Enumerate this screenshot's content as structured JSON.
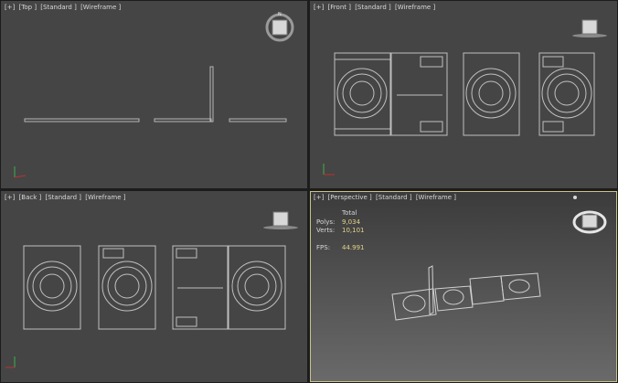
{
  "viewports": {
    "top": {
      "menu": "[+]",
      "view": "[Top ]",
      "shading": "[Standard ]",
      "mode": "[Wireframe ]"
    },
    "front": {
      "menu": "[+]",
      "view": "[Front ]",
      "shading": "[Standard ]",
      "mode": "[Wireframe ]"
    },
    "back": {
      "menu": "[+]",
      "view": "[Back ]",
      "shading": "[Standard ]",
      "mode": "[Wireframe ]"
    },
    "perspective": {
      "menu": "[+]",
      "view": "[Perspective ]",
      "shading": "[Standard ]",
      "mode": "[Wireframe ]"
    }
  },
  "stats": {
    "total_label": "Total",
    "polys_label": "Polys:",
    "polys_value": "9,034",
    "verts_label": "Verts:",
    "verts_value": "10,101",
    "fps_label": "FPS:",
    "fps_value": "44.991"
  },
  "colors": {
    "viewport_bg": "#454545",
    "border": "#1c1c1c",
    "active_border": "#c9c28a",
    "wire": "#c8c8c8",
    "stat_value": "#e2d28a"
  },
  "icons": [
    "viewcube-icon",
    "axis-tripod-icon",
    "steering-wheel-icon"
  ]
}
